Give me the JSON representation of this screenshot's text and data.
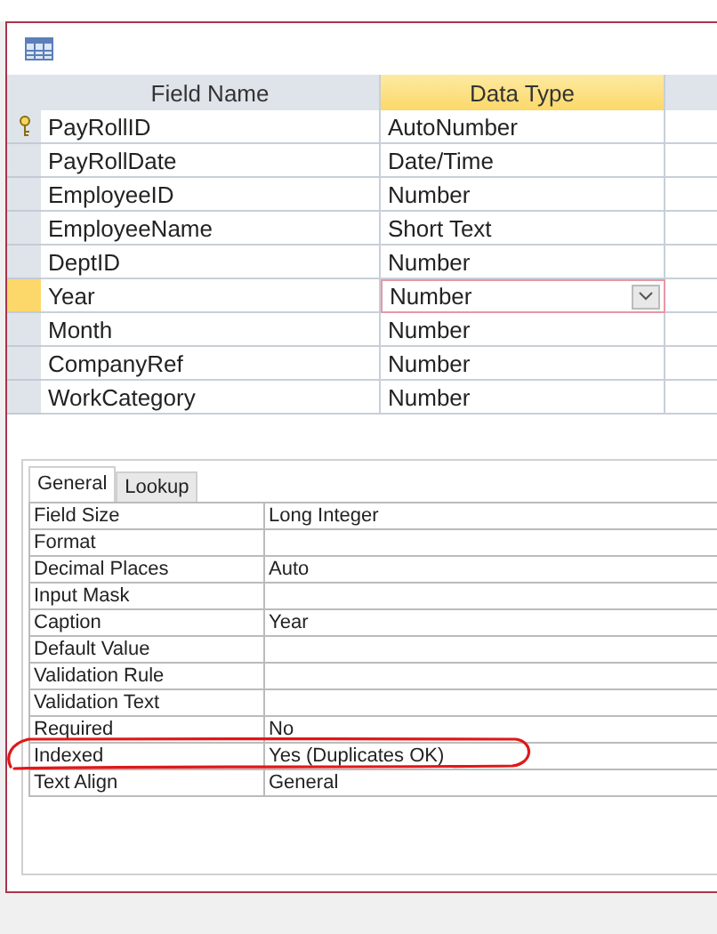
{
  "columns": [
    {
      "label": "Field Name",
      "selected": false
    },
    {
      "label": "Data Type",
      "selected": true
    }
  ],
  "fields": [
    {
      "name": "PayRollID",
      "type": "AutoNumber",
      "primary_key": true,
      "selected": false
    },
    {
      "name": "PayRollDate",
      "type": "Date/Time",
      "primary_key": false,
      "selected": false
    },
    {
      "name": "EmployeeID",
      "type": "Number",
      "primary_key": false,
      "selected": false
    },
    {
      "name": "EmployeeName",
      "type": "Short Text",
      "primary_key": false,
      "selected": false
    },
    {
      "name": "DeptID",
      "type": "Number",
      "primary_key": false,
      "selected": false
    },
    {
      "name": "Year",
      "type": "Number",
      "primary_key": false,
      "selected": true
    },
    {
      "name": "Month",
      "type": "Number",
      "primary_key": false,
      "selected": false
    },
    {
      "name": "CompanyRef",
      "type": "Number",
      "primary_key": false,
      "selected": false
    },
    {
      "name": "WorkCategory",
      "type": "Number",
      "primary_key": false,
      "selected": false
    }
  ],
  "property_tabs": [
    {
      "label": "General",
      "selected": true
    },
    {
      "label": "Lookup",
      "selected": false
    }
  ],
  "properties": [
    {
      "label": "Field Size",
      "value": "Long Integer"
    },
    {
      "label": "Format"
    },
    {
      "label": "Decimal Places",
      "value": "Auto"
    },
    {
      "label": "Input Mask"
    },
    {
      "label": "Caption",
      "value": "Year"
    },
    {
      "label": "Default Value"
    },
    {
      "label": "Validation Rule"
    },
    {
      "label": "Validation Text"
    },
    {
      "label": "Required",
      "value": "No"
    },
    {
      "label": "Indexed",
      "value": "Yes (Duplicates OK)"
    },
    {
      "label": "Text Align",
      "value": "General"
    }
  ]
}
